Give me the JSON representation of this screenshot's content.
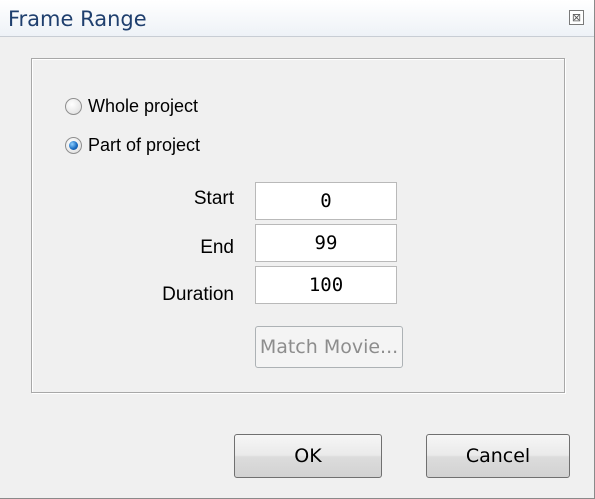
{
  "window": {
    "title": "Frame Range",
    "close_glyph": "⊠"
  },
  "range": {
    "options": [
      {
        "label": "Whole project",
        "checked": false
      },
      {
        "label": "Part of project",
        "checked": true
      }
    ]
  },
  "fields": {
    "start": {
      "label": "Start",
      "value": "0"
    },
    "end": {
      "label": "End",
      "value": "99"
    },
    "duration": {
      "label": "Duration",
      "value": "100"
    }
  },
  "buttons": {
    "match_movie": "Match Movie...",
    "ok": "OK",
    "cancel": "Cancel"
  }
}
